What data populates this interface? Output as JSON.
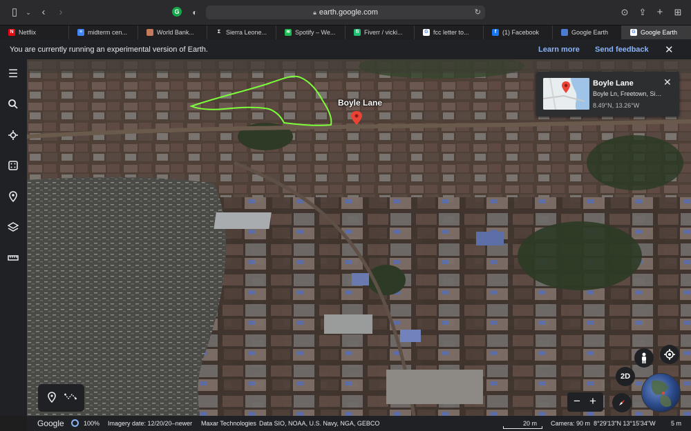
{
  "browser": {
    "url": "earth.google.com",
    "grammarly_badge": "G"
  },
  "tabs": [
    {
      "label": "Netflix",
      "fav_color": "#e50914",
      "fav_glyph": "N"
    },
    {
      "label": "midterm cen...",
      "fav_color": "#4285f4",
      "fav_glyph": "≡"
    },
    {
      "label": "World Bank...",
      "fav_color": "#c47a5a",
      "fav_glyph": ""
    },
    {
      "label": "Sierra Leone...",
      "fav_color": "#1f1f21",
      "fav_glyph": "Σ"
    },
    {
      "label": "Spotify – We...",
      "fav_color": "#1db954",
      "fav_glyph": "≋"
    },
    {
      "label": "Fiverr / vicki...",
      "fav_color": "#1dbf73",
      "fav_glyph": "fi"
    },
    {
      "label": "fcc letter to...",
      "fav_color": "#ffffff",
      "fav_glyph": "G"
    },
    {
      "label": "(1) Facebook",
      "fav_color": "#1877f2",
      "fav_glyph": "f"
    },
    {
      "label": "Google Earth",
      "fav_color": "#4a7bd0",
      "fav_glyph": ""
    },
    {
      "label": "Google Earth",
      "fav_color": "#ffffff",
      "fav_glyph": "G",
      "active": true
    }
  ],
  "banner": {
    "message": "You are currently running an experimental version of Earth.",
    "learn_more": "Learn more",
    "send_feedback": "Send feedback"
  },
  "map": {
    "place_label": "Boyle Lane"
  },
  "card": {
    "title": "Boyle Lane",
    "address": "Boyle Ln, Freetown, Sie...",
    "coords": "8.49°N, 13.26°W"
  },
  "controls": {
    "view_mode": "2D",
    "zoom_out": "−",
    "zoom_in": "+"
  },
  "status": {
    "logo": "Google",
    "load_percent": "100%",
    "imagery_date": "Imagery date: 12/20/20–newer",
    "provider": "Maxar Technologies",
    "data_credits": "Data SIO, NOAA, U.S. Navy, NGA, GEBCO",
    "scale": "20 m",
    "camera": "Camera: 90 m",
    "position": "8°29'13\"N 13°15'34\"W",
    "elevation": "5 m"
  },
  "colors": {
    "accent": "#8ab4f8",
    "outline": "#7cff3a",
    "pin": "#ea4335"
  }
}
